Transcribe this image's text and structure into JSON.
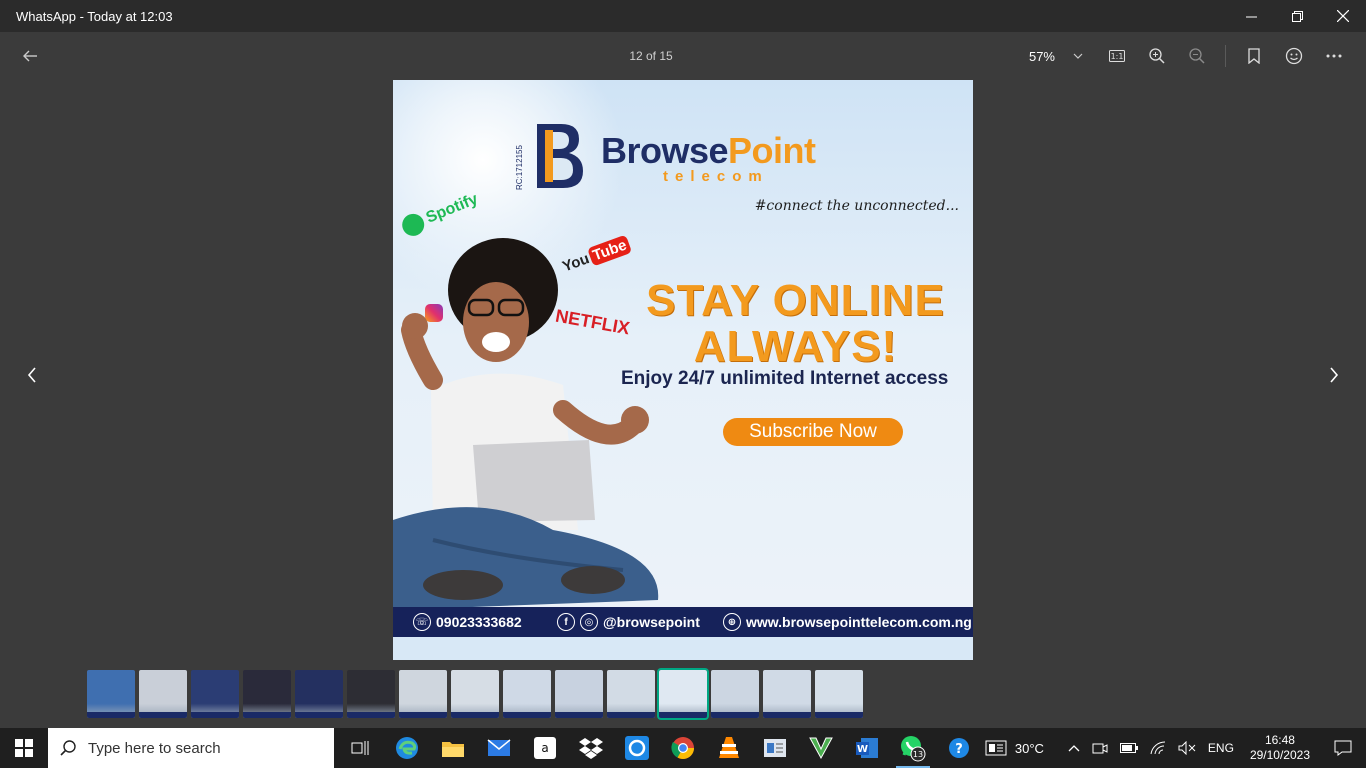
{
  "window": {
    "title": "WhatsApp - Today at 12:03"
  },
  "toolbar": {
    "counter": "12 of 15",
    "zoom": "57%"
  },
  "poster": {
    "rc": "RC:1712155",
    "brand_part1": "Browse",
    "brand_part2": "Point",
    "brand_sub": "telecom",
    "tagline": "#connect the unconnected...",
    "headline_line1": "STAY ONLINE",
    "headline_line2": "ALWAYS!",
    "subline": "Enjoy 24/7 unlimited Internet access",
    "cta": "Subscribe Now",
    "brands": {
      "spotify": "Spotify",
      "youtube_you": "You",
      "youtube_tube": "Tube",
      "netflix": "NETFLIX"
    },
    "phone": "09023333682",
    "social": "@browsepoint",
    "website": "www.browsepointtelecom.com.ng"
  },
  "thumbnails": [
    {
      "color": "#3f6fb0",
      "selected": false
    },
    {
      "color": "#c9cfd8",
      "selected": false
    },
    {
      "color": "#2b3d74",
      "selected": false
    },
    {
      "color": "#2a2a3a",
      "selected": false
    },
    {
      "color": "#243060",
      "selected": false
    },
    {
      "color": "#2d2d34",
      "selected": false
    },
    {
      "color": "#cfd6de",
      "selected": false
    },
    {
      "color": "#d6dde5",
      "selected": false
    },
    {
      "color": "#cfd9e6",
      "selected": false
    },
    {
      "color": "#c8d2e0",
      "selected": false
    },
    {
      "color": "#d2dbe5",
      "selected": false
    },
    {
      "color": "#dfe8f2",
      "selected": true
    },
    {
      "color": "#ccd6e2",
      "selected": false
    },
    {
      "color": "#d0dae6",
      "selected": false
    },
    {
      "color": "#d5dfe9",
      "selected": false
    }
  ],
  "taskbar": {
    "search_placeholder": "Type here to search",
    "whatsapp_badge": "13",
    "weather": "30°C",
    "language": "ENG",
    "time": "16:48",
    "date": "29/10/2023"
  }
}
